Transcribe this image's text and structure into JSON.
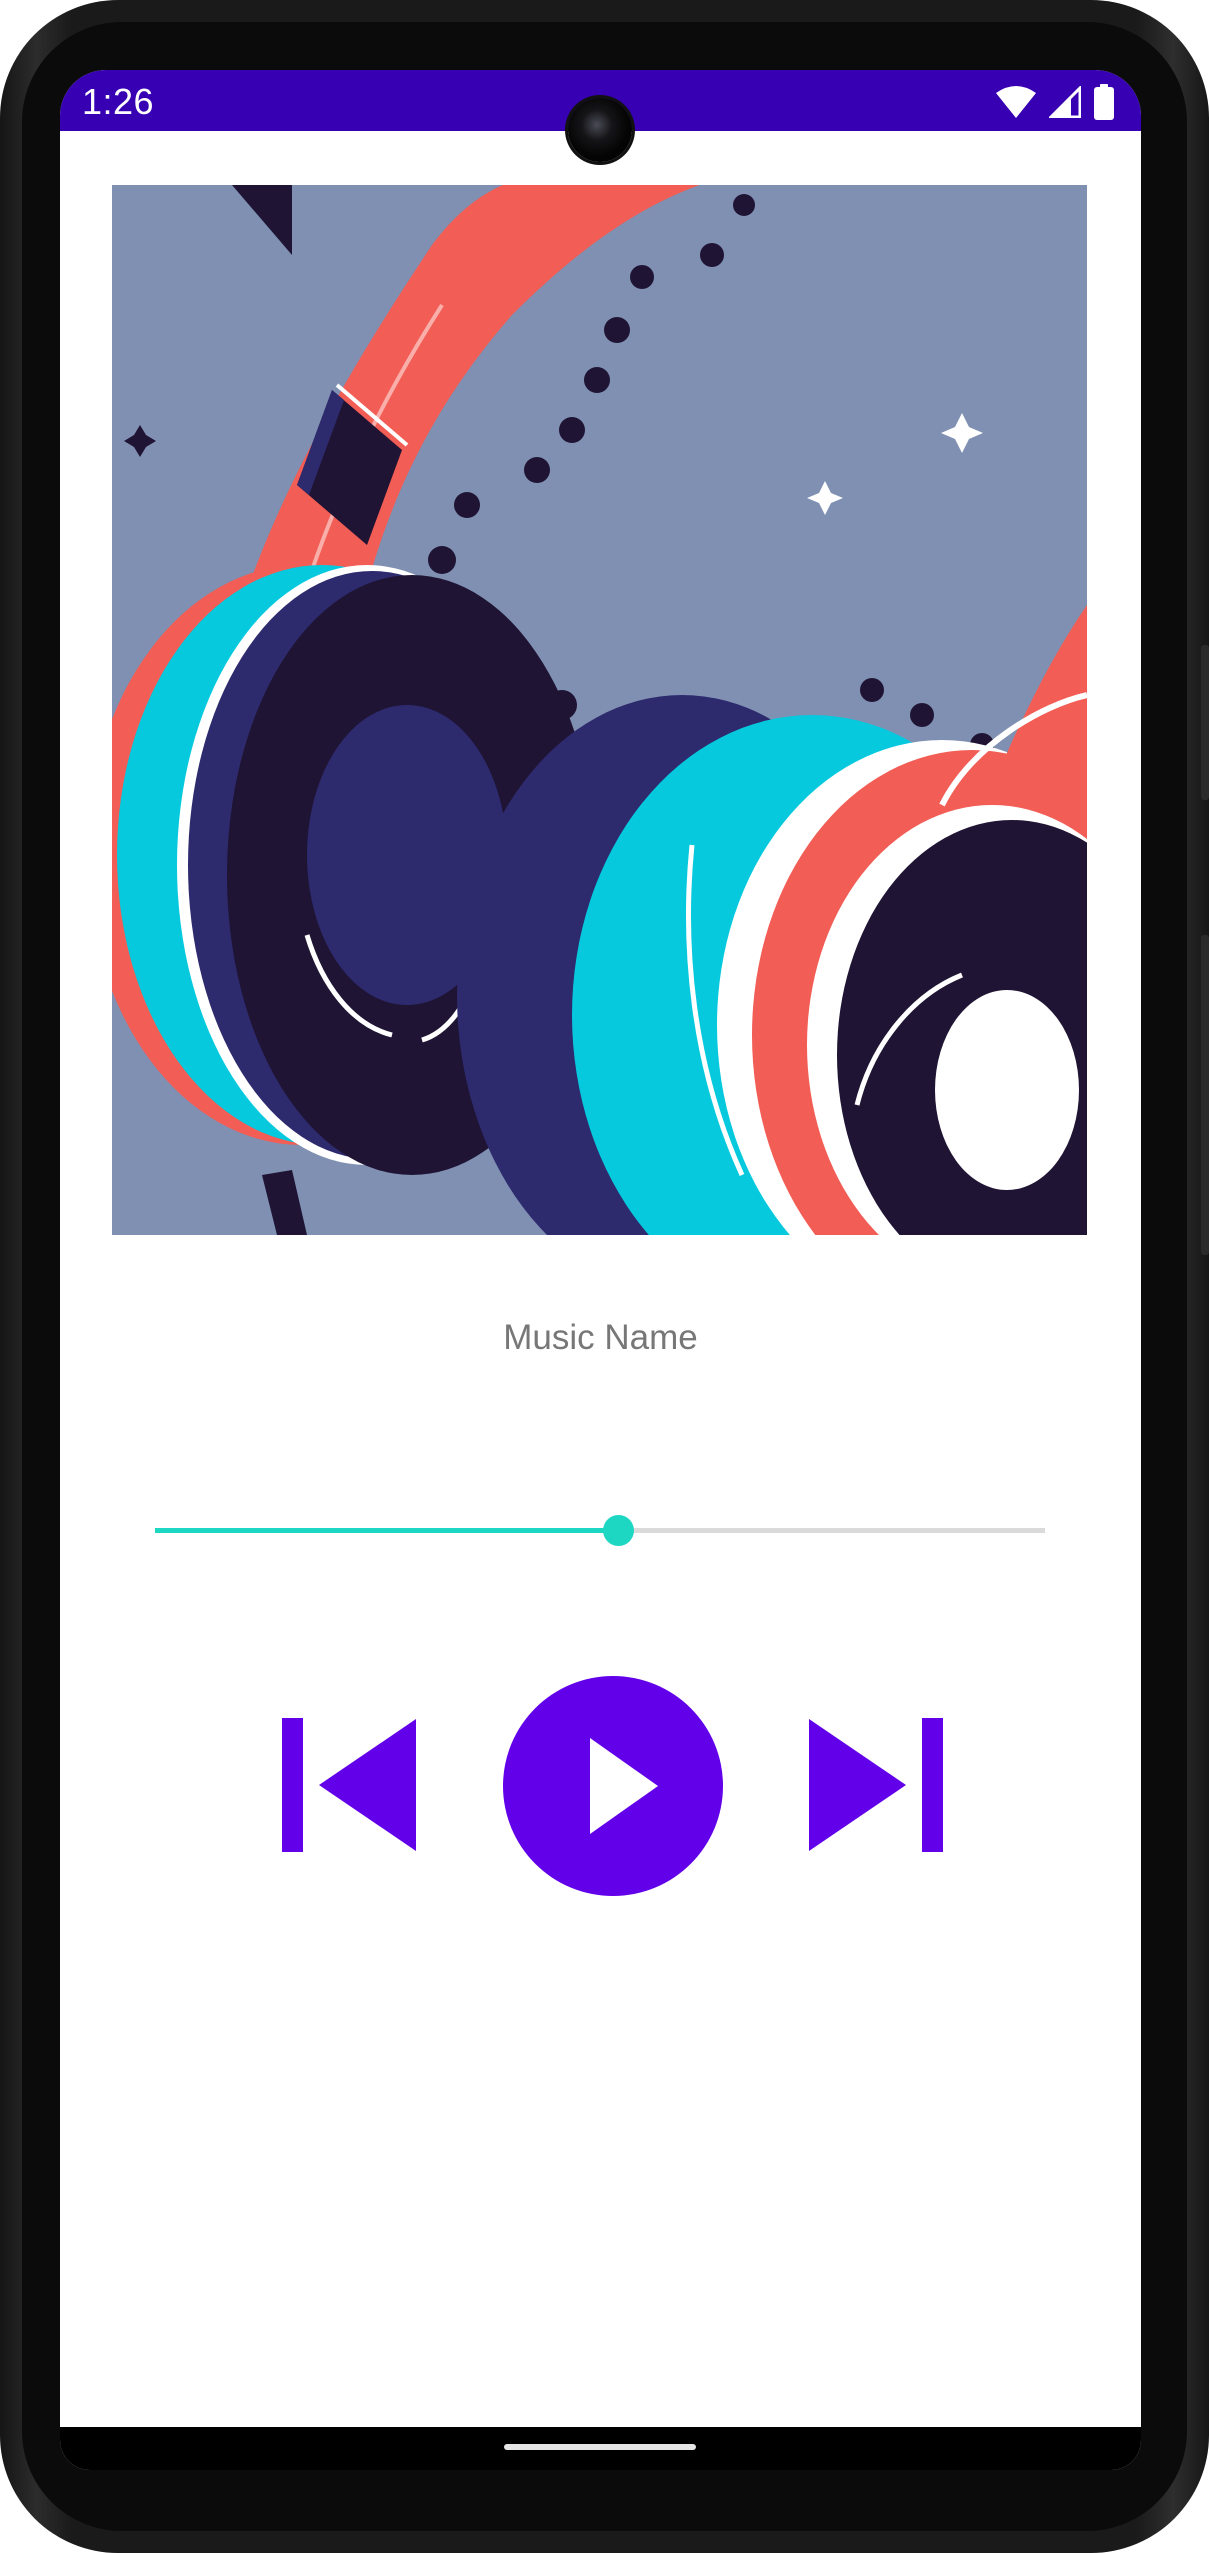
{
  "status_bar": {
    "time": "1:26",
    "background_color": "#3700b3",
    "icons": [
      "wifi-icon",
      "signal-icon",
      "battery-icon"
    ]
  },
  "album_art": {
    "icon": "headphones-illustration",
    "colors": {
      "background": "#7f90b2",
      "band": "#f25d55",
      "cushion": "#06c9de",
      "cup": "#2d2a6e",
      "dark": "#1f1433"
    }
  },
  "track": {
    "title": "Music Name"
  },
  "seekbar": {
    "progress": 0.52,
    "accent_color": "#1ed7c3",
    "track_color": "#dadada"
  },
  "controls": {
    "color": "#6200ea",
    "previous_icon": "skip-previous-icon",
    "play_icon": "play-icon",
    "next_icon": "skip-next-icon"
  }
}
